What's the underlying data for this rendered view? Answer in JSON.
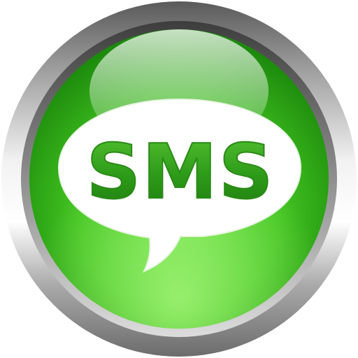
{
  "icon": {
    "name": "sms-message-icon",
    "label": "SMS"
  },
  "colors": {
    "ring_light": "#f4f4f4",
    "ring_mid": "#b9b9b9",
    "ring_dark": "#4a4a4a",
    "green_light": "#7ee65a",
    "green_mid": "#3ec21c",
    "green_dark": "#1f8a10",
    "bubble": "#ffffff",
    "text_green": "#2f9a1e",
    "text_green_dark": "#1f6f12"
  }
}
